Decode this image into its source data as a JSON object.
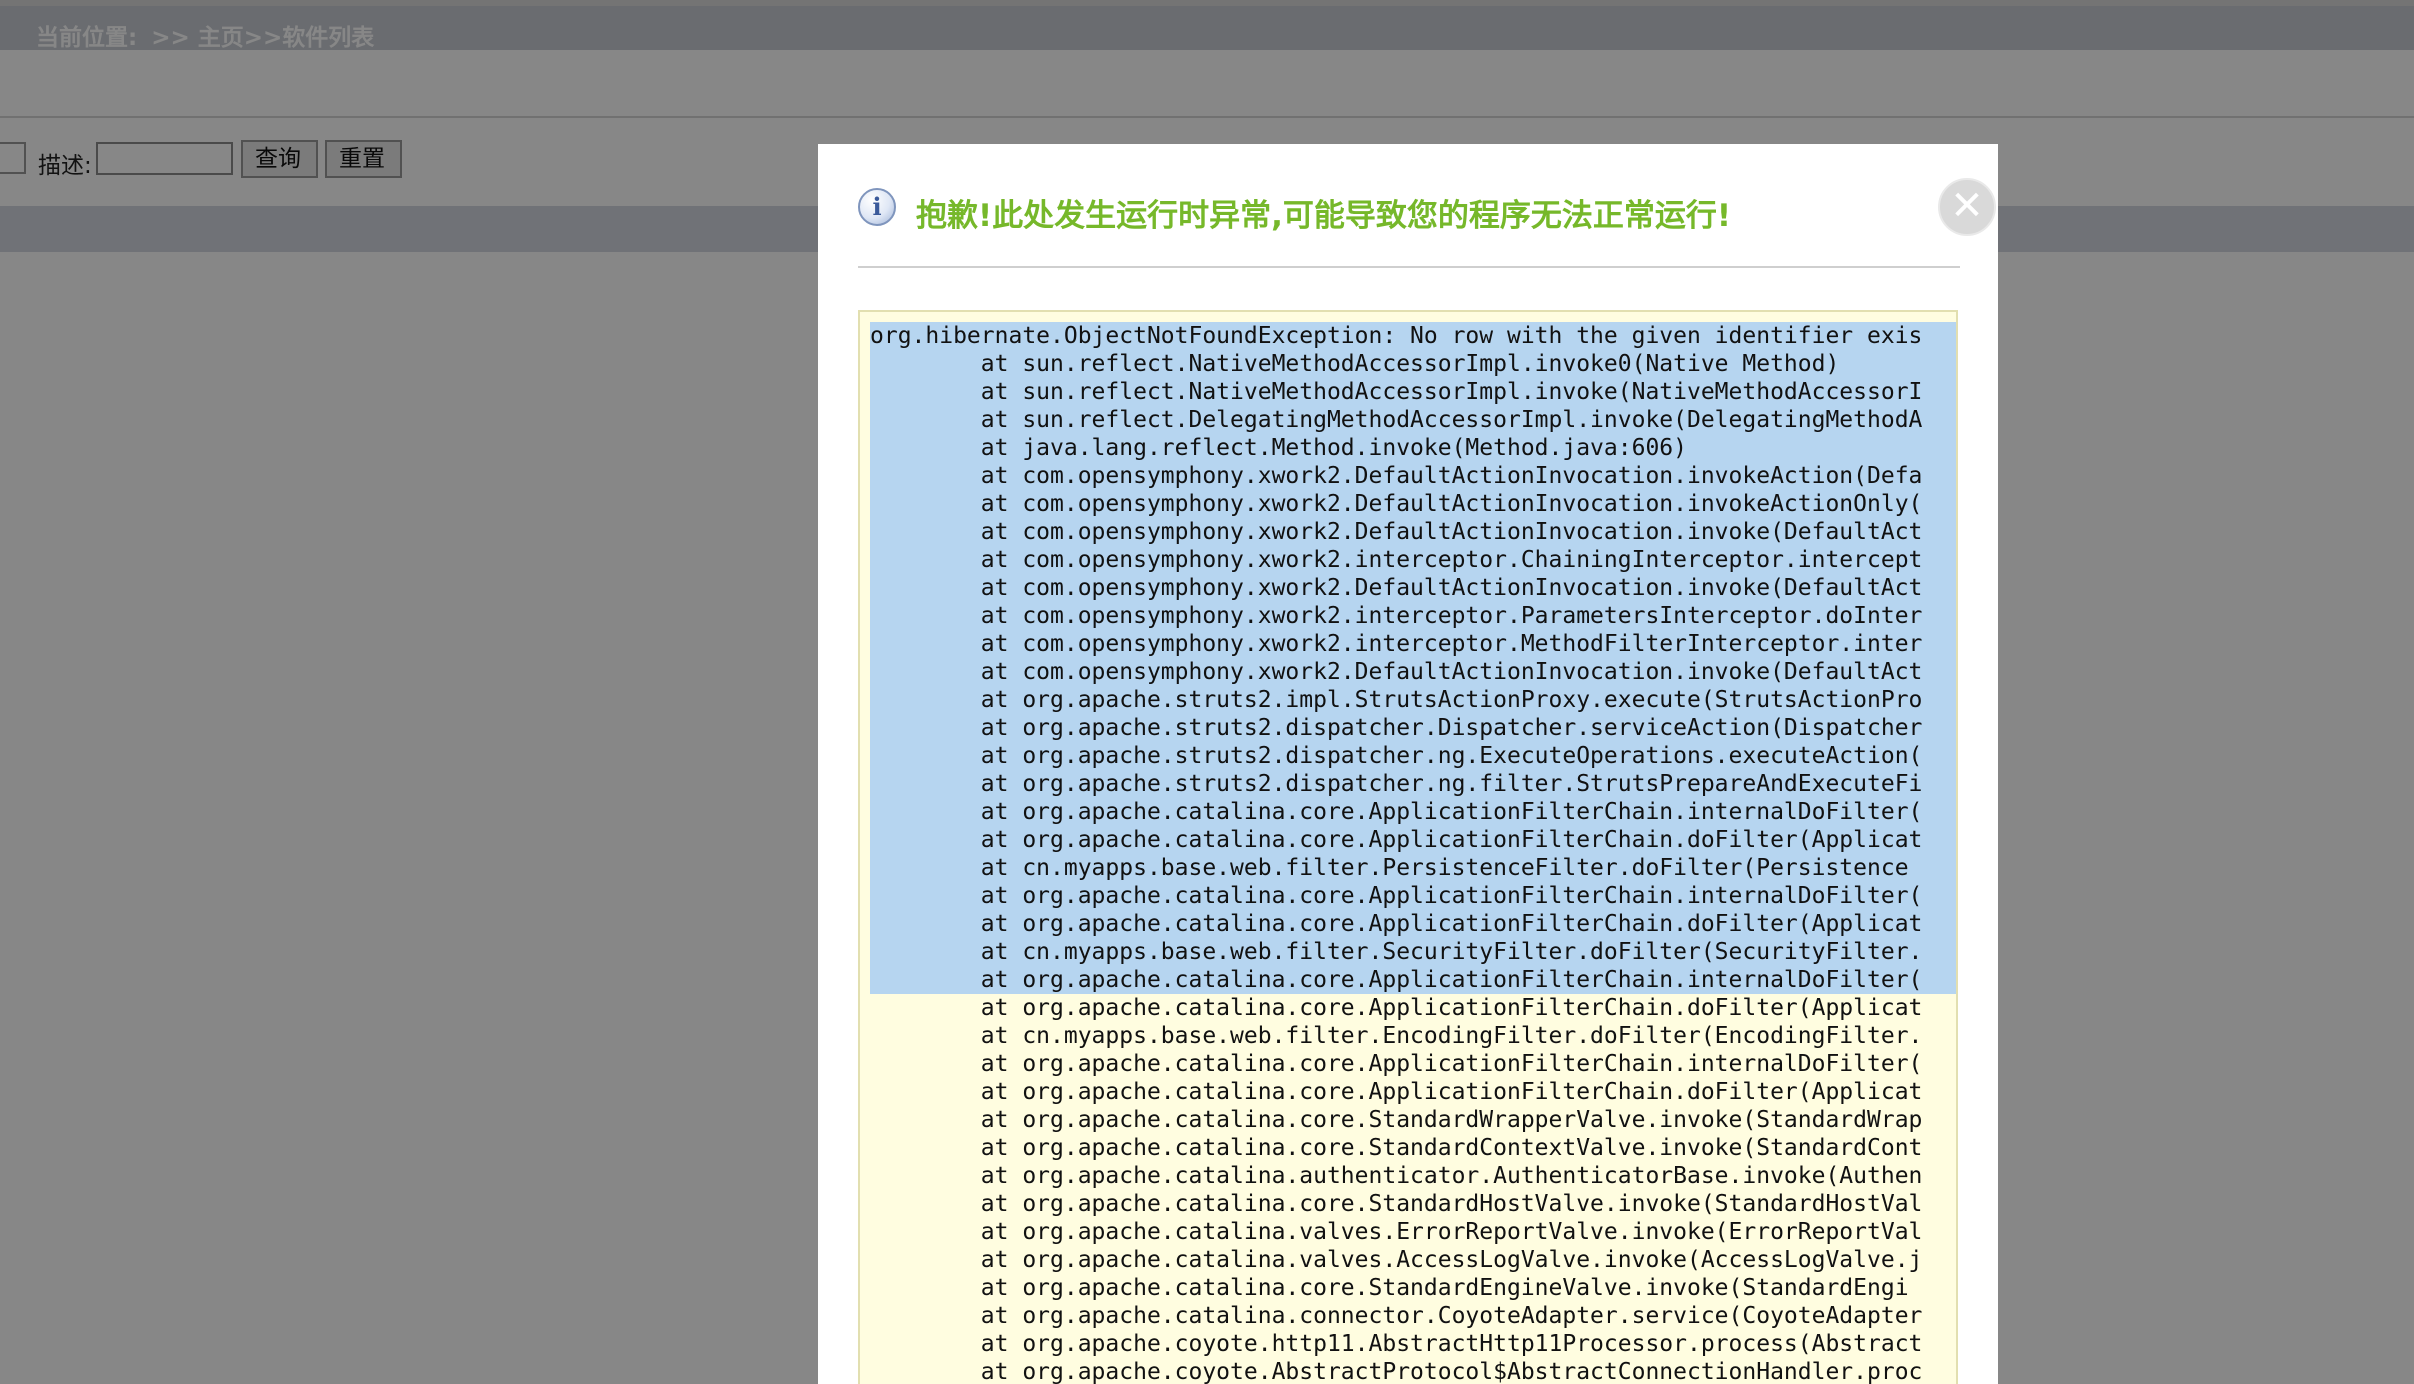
{
  "breadcrumb": {
    "prefix": "当前位置:",
    "path": ">> 主页>>软件列表"
  },
  "search": {
    "desc_label": "描述:",
    "desc_value": "",
    "query_button": "查询",
    "reset_button": "重置"
  },
  "dialog": {
    "title": "抱歉!此处发生运行时异常,可能导致您的程序无法正常运行!",
    "info_icon": "i",
    "close_icon": "✕",
    "trace_lines": [
      "org.hibernate.ObjectNotFoundException: No row with the given identifier exis",
      "        at sun.reflect.NativeMethodAccessorImpl.invoke0(Native Method)",
      "        at sun.reflect.NativeMethodAccessorImpl.invoke(NativeMethodAccessorI",
      "        at sun.reflect.DelegatingMethodAccessorImpl.invoke(DelegatingMethodA",
      "        at java.lang.reflect.Method.invoke(Method.java:606)",
      "        at com.opensymphony.xwork2.DefaultActionInvocation.invokeAction(Defa",
      "        at com.opensymphony.xwork2.DefaultActionInvocation.invokeActionOnly(",
      "        at com.opensymphony.xwork2.DefaultActionInvocation.invoke(DefaultAct",
      "        at com.opensymphony.xwork2.interceptor.ChainingInterceptor.intercept",
      "        at com.opensymphony.xwork2.DefaultActionInvocation.invoke(DefaultAct",
      "        at com.opensymphony.xwork2.interceptor.ParametersInterceptor.doInter",
      "        at com.opensymphony.xwork2.interceptor.MethodFilterInterceptor.inter",
      "        at com.opensymphony.xwork2.DefaultActionInvocation.invoke(DefaultAct",
      "        at org.apache.struts2.impl.StrutsActionProxy.execute(StrutsActionPro",
      "        at org.apache.struts2.dispatcher.Dispatcher.serviceAction(Dispatcher",
      "        at org.apache.struts2.dispatcher.ng.ExecuteOperations.executeAction(",
      "        at org.apache.struts2.dispatcher.ng.filter.StrutsPrepareAndExecuteFi",
      "        at org.apache.catalina.core.ApplicationFilterChain.internalDoFilter(",
      "        at org.apache.catalina.core.ApplicationFilterChain.doFilter(Applicat",
      "        at cn.myapps.base.web.filter.PersistenceFilter.doFilter(Persistence",
      "        at org.apache.catalina.core.ApplicationFilterChain.internalDoFilter(",
      "        at org.apache.catalina.core.ApplicationFilterChain.doFilter(Applicat",
      "        at cn.myapps.base.web.filter.SecurityFilter.doFilter(SecurityFilter.",
      "        at org.apache.catalina.core.ApplicationFilterChain.internalDoFilter(",
      "        at org.apache.catalina.core.ApplicationFilterChain.doFilter(Applicat",
      "        at cn.myapps.base.web.filter.EncodingFilter.doFilter(EncodingFilter.",
      "        at org.apache.catalina.core.ApplicationFilterChain.internalDoFilter(",
      "        at org.apache.catalina.core.ApplicationFilterChain.doFilter(Applicat",
      "        at org.apache.catalina.core.StandardWrapperValve.invoke(StandardWrap",
      "        at org.apache.catalina.core.StandardContextValve.invoke(StandardCont",
      "        at org.apache.catalina.authenticator.AuthenticatorBase.invoke(Authen",
      "        at org.apache.catalina.core.StandardHostValve.invoke(StandardHostVal",
      "        at org.apache.catalina.valves.ErrorReportValve.invoke(ErrorReportVal",
      "        at org.apache.catalina.valves.AccessLogValve.invoke(AccessLogValve.j",
      "        at org.apache.catalina.core.StandardEngineValve.invoke(StandardEngi",
      "        at org.apache.catalina.connector.CoyoteAdapter.service(CoyoteAdapter",
      "        at org.apache.coyote.http11.AbstractHttp11Processor.process(Abstract",
      "        at org.apache.coyote.AbstractProtocol$AbstractConnectionHandler.proc"
    ],
    "selected_line_count": 24
  }
}
